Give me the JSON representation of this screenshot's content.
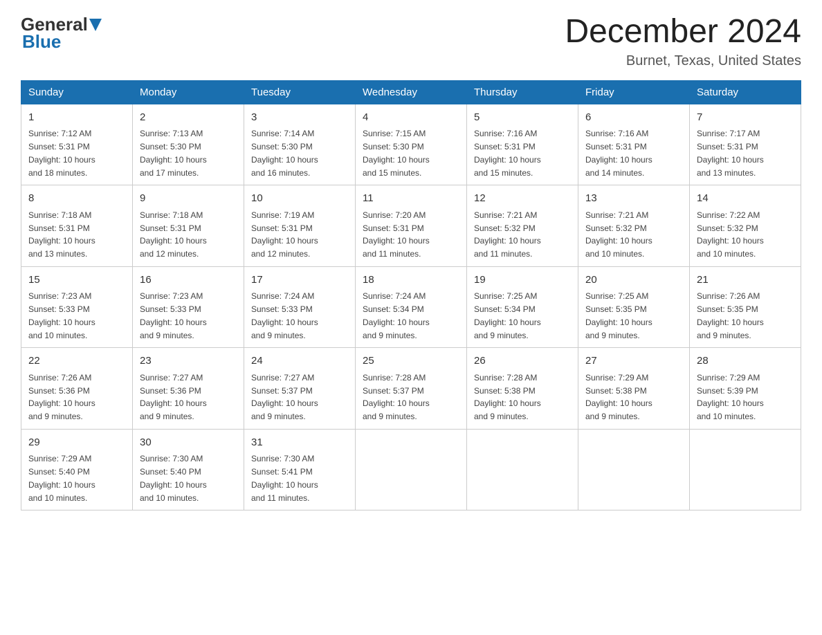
{
  "header": {
    "logo_general": "General",
    "logo_blue": "Blue",
    "month_title": "December 2024",
    "location": "Burnet, Texas, United States"
  },
  "weekdays": [
    "Sunday",
    "Monday",
    "Tuesday",
    "Wednesday",
    "Thursday",
    "Friday",
    "Saturday"
  ],
  "weeks": [
    [
      {
        "day": "1",
        "sunrise": "7:12 AM",
        "sunset": "5:31 PM",
        "daylight": "10 hours and 18 minutes."
      },
      {
        "day": "2",
        "sunrise": "7:13 AM",
        "sunset": "5:30 PM",
        "daylight": "10 hours and 17 minutes."
      },
      {
        "day": "3",
        "sunrise": "7:14 AM",
        "sunset": "5:30 PM",
        "daylight": "10 hours and 16 minutes."
      },
      {
        "day": "4",
        "sunrise": "7:15 AM",
        "sunset": "5:30 PM",
        "daylight": "10 hours and 15 minutes."
      },
      {
        "day": "5",
        "sunrise": "7:16 AM",
        "sunset": "5:31 PM",
        "daylight": "10 hours and 15 minutes."
      },
      {
        "day": "6",
        "sunrise": "7:16 AM",
        "sunset": "5:31 PM",
        "daylight": "10 hours and 14 minutes."
      },
      {
        "day": "7",
        "sunrise": "7:17 AM",
        "sunset": "5:31 PM",
        "daylight": "10 hours and 13 minutes."
      }
    ],
    [
      {
        "day": "8",
        "sunrise": "7:18 AM",
        "sunset": "5:31 PM",
        "daylight": "10 hours and 13 minutes."
      },
      {
        "day": "9",
        "sunrise": "7:18 AM",
        "sunset": "5:31 PM",
        "daylight": "10 hours and 12 minutes."
      },
      {
        "day": "10",
        "sunrise": "7:19 AM",
        "sunset": "5:31 PM",
        "daylight": "10 hours and 12 minutes."
      },
      {
        "day": "11",
        "sunrise": "7:20 AM",
        "sunset": "5:31 PM",
        "daylight": "10 hours and 11 minutes."
      },
      {
        "day": "12",
        "sunrise": "7:21 AM",
        "sunset": "5:32 PM",
        "daylight": "10 hours and 11 minutes."
      },
      {
        "day": "13",
        "sunrise": "7:21 AM",
        "sunset": "5:32 PM",
        "daylight": "10 hours and 10 minutes."
      },
      {
        "day": "14",
        "sunrise": "7:22 AM",
        "sunset": "5:32 PM",
        "daylight": "10 hours and 10 minutes."
      }
    ],
    [
      {
        "day": "15",
        "sunrise": "7:23 AM",
        "sunset": "5:33 PM",
        "daylight": "10 hours and 10 minutes."
      },
      {
        "day": "16",
        "sunrise": "7:23 AM",
        "sunset": "5:33 PM",
        "daylight": "10 hours and 9 minutes."
      },
      {
        "day": "17",
        "sunrise": "7:24 AM",
        "sunset": "5:33 PM",
        "daylight": "10 hours and 9 minutes."
      },
      {
        "day": "18",
        "sunrise": "7:24 AM",
        "sunset": "5:34 PM",
        "daylight": "10 hours and 9 minutes."
      },
      {
        "day": "19",
        "sunrise": "7:25 AM",
        "sunset": "5:34 PM",
        "daylight": "10 hours and 9 minutes."
      },
      {
        "day": "20",
        "sunrise": "7:25 AM",
        "sunset": "5:35 PM",
        "daylight": "10 hours and 9 minutes."
      },
      {
        "day": "21",
        "sunrise": "7:26 AM",
        "sunset": "5:35 PM",
        "daylight": "10 hours and 9 minutes."
      }
    ],
    [
      {
        "day": "22",
        "sunrise": "7:26 AM",
        "sunset": "5:36 PM",
        "daylight": "10 hours and 9 minutes."
      },
      {
        "day": "23",
        "sunrise": "7:27 AM",
        "sunset": "5:36 PM",
        "daylight": "10 hours and 9 minutes."
      },
      {
        "day": "24",
        "sunrise": "7:27 AM",
        "sunset": "5:37 PM",
        "daylight": "10 hours and 9 minutes."
      },
      {
        "day": "25",
        "sunrise": "7:28 AM",
        "sunset": "5:37 PM",
        "daylight": "10 hours and 9 minutes."
      },
      {
        "day": "26",
        "sunrise": "7:28 AM",
        "sunset": "5:38 PM",
        "daylight": "10 hours and 9 minutes."
      },
      {
        "day": "27",
        "sunrise": "7:29 AM",
        "sunset": "5:38 PM",
        "daylight": "10 hours and 9 minutes."
      },
      {
        "day": "28",
        "sunrise": "7:29 AM",
        "sunset": "5:39 PM",
        "daylight": "10 hours and 10 minutes."
      }
    ],
    [
      {
        "day": "29",
        "sunrise": "7:29 AM",
        "sunset": "5:40 PM",
        "daylight": "10 hours and 10 minutes."
      },
      {
        "day": "30",
        "sunrise": "7:30 AM",
        "sunset": "5:40 PM",
        "daylight": "10 hours and 10 minutes."
      },
      {
        "day": "31",
        "sunrise": "7:30 AM",
        "sunset": "5:41 PM",
        "daylight": "10 hours and 11 minutes."
      },
      null,
      null,
      null,
      null
    ]
  ],
  "labels": {
    "sunrise": "Sunrise:",
    "sunset": "Sunset:",
    "daylight": "Daylight:"
  }
}
